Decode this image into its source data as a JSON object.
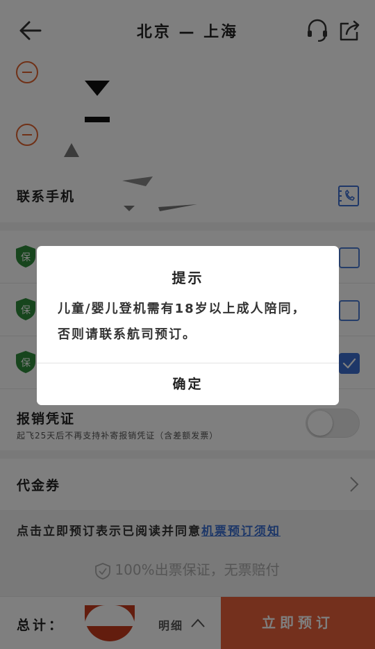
{
  "header": {
    "title": "北京 — 上海"
  },
  "contact": {
    "label": "联系手机"
  },
  "insurance": {
    "badge": "保",
    "checked": [
      false,
      false,
      true
    ]
  },
  "invoice": {
    "title": "报销凭证",
    "subtitle": "起飞25天后不再支持补寄报销凭证（含差额发票）",
    "enabled": false
  },
  "voucher": {
    "label": "代金券"
  },
  "notice": {
    "prefix": "点击立即预订表示已阅读并同意",
    "link": "机票预订须知"
  },
  "guarantee": {
    "text": "100%出票保证，无票赔付"
  },
  "bottom_bar": {
    "total_label": "总计：",
    "detail_label": "明细",
    "book_button": "立即预订"
  },
  "dialog": {
    "title": "提示",
    "message": "儿童/婴儿登机需有18岁以上成人陪同，否则请联系航司预订。",
    "confirm": "确定"
  },
  "colors": {
    "accent": "#e8603b",
    "link": "#3a6fd1",
    "shield": "#2e8b3a"
  }
}
